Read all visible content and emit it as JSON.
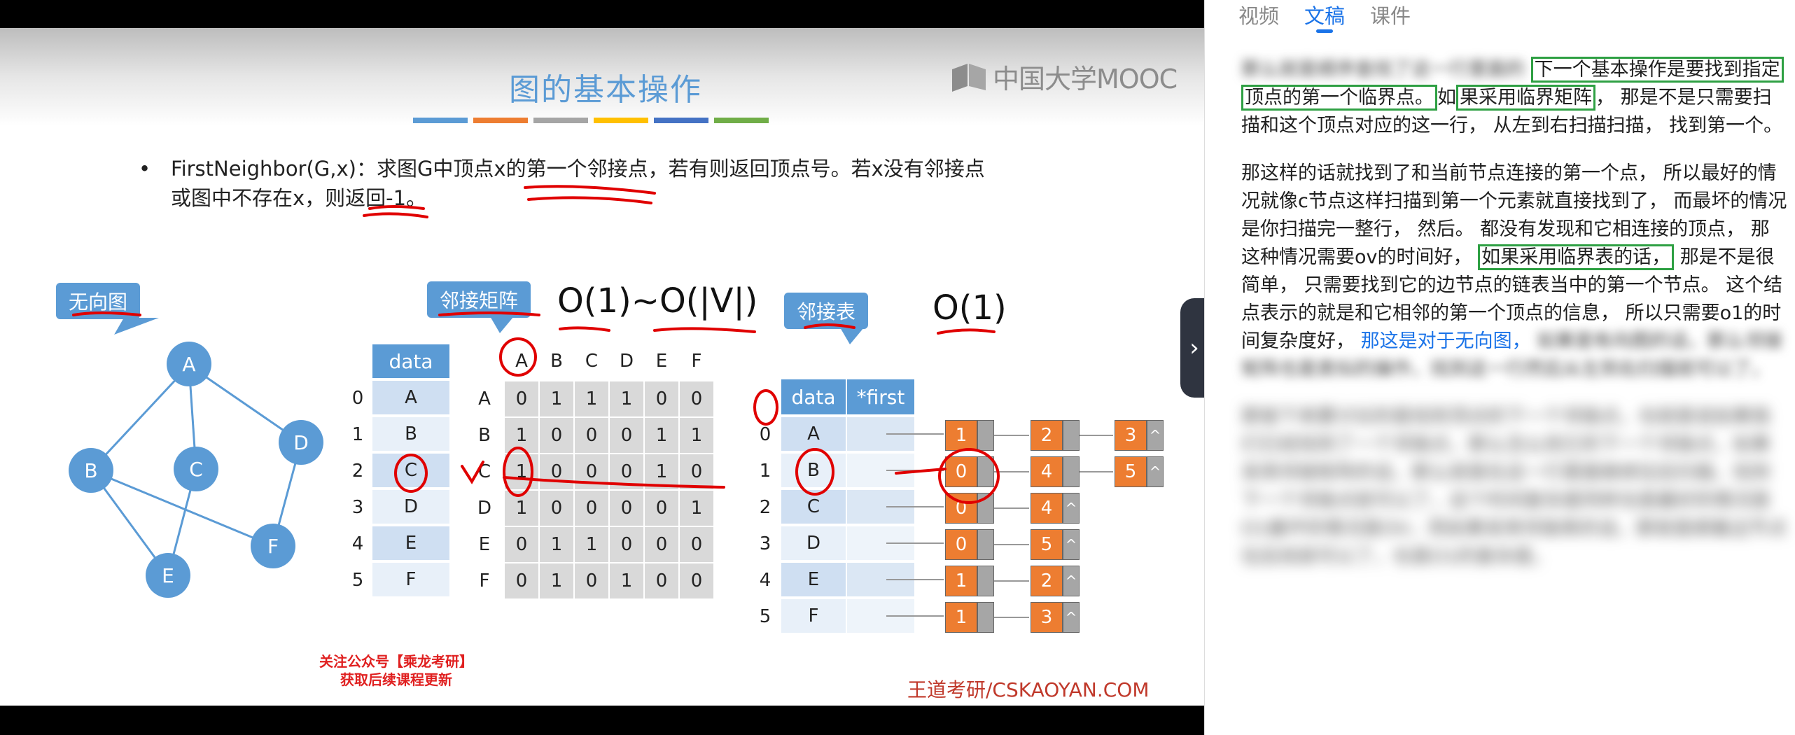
{
  "slide": {
    "title": "图的基本操作",
    "title_bar_colors": [
      "#5b9bd5",
      "#ed7d31",
      "#a5a5a5",
      "#ffc000",
      "#4472c4",
      "#70ad47"
    ],
    "logo_text": "中国大学MOOC",
    "bullet_dot": "•",
    "bullet_line1": "FirstNeighbor(G,x)：求图G中顶点x的第一个邻接点，若有则返回顶点号。若x没有邻接点",
    "bullet_line2": "或图中不存在x，则返回-1。",
    "callout_undirected": "无向图",
    "callout_matrix": "邻接矩阵",
    "callout_list": "邻接表",
    "complexity_matrix": "O(1)~O(|V|)",
    "complexity_list": "O(1)",
    "watermark_line1": "关注公众号【乘龙考研】",
    "watermark_line2": "获取后续课程更新",
    "watermark_site": "王道考研/CSKAOYAN.COM"
  },
  "graph": {
    "nodes": [
      "A",
      "B",
      "C",
      "D",
      "E",
      "F"
    ],
    "node_color": "#5b9bd5"
  },
  "vertex_table": {
    "header": "data",
    "indices": [
      "0",
      "1",
      "2",
      "3",
      "4",
      "5"
    ],
    "values": [
      "A",
      "B",
      "C",
      "D",
      "E",
      "F"
    ]
  },
  "matrix": {
    "col_headers": [
      "A",
      "B",
      "C",
      "D",
      "E",
      "F"
    ],
    "row_headers": [
      "A",
      "B",
      "C",
      "D",
      "E",
      "F"
    ],
    "rows": [
      [
        "0",
        "1",
        "1",
        "1",
        "0",
        "0"
      ],
      [
        "1",
        "0",
        "0",
        "0",
        "1",
        "1"
      ],
      [
        "1",
        "0",
        "0",
        "0",
        "1",
        "0"
      ],
      [
        "1",
        "0",
        "0",
        "0",
        "0",
        "1"
      ],
      [
        "0",
        "1",
        "1",
        "0",
        "0",
        "0"
      ],
      [
        "0",
        "1",
        "0",
        "1",
        "0",
        "0"
      ]
    ],
    "annotation_mark": "√"
  },
  "adj_list": {
    "header_data": "data",
    "header_first": "*first",
    "indices": [
      "0",
      "1",
      "2",
      "3",
      "4",
      "5"
    ],
    "vertices": [
      "A",
      "B",
      "C",
      "D",
      "E",
      "F"
    ],
    "chains": [
      [
        "1",
        "2",
        "3"
      ],
      [
        "0",
        "4",
        "5"
      ],
      [
        "0",
        "4"
      ],
      [
        "0",
        "5"
      ],
      [
        "1",
        "2"
      ],
      [
        "1",
        "3"
      ]
    ],
    "null_mark": "^",
    "node_color": "#ed7d31"
  },
  "panel": {
    "tabs": [
      "视频",
      "文稿",
      "课件"
    ],
    "active_tab": "文稿",
    "collapse_icon": "›",
    "p1_blur": "那么就是顺序查找了这一行里面的",
    "p1_box1": "下一个基本操作是要找到指定",
    "p1_box2": "顶点的第一个临界点。",
    "p1_t1": "如",
    "p1_box3": "果采用临界矩阵",
    "p1_t2": "， 那是不是只需要扫描和这个顶点对应的这一行， 从左到右扫描扫描， 找到第一个。",
    "p2_t1": "那这样的话就找到了和当前节点连接的第一个点， 所以最好的情况就像c节点这样扫描到第一个元素就直接找到了， 而最坏的情况是你扫描完一整行， 然后。 都没有发现和它相连接的顶点， 那这种情况需要ov的时间好，",
    "p2_box": "如果采用临界表的话，",
    "p2_t2": "那是不是很简单， 只需要找到它的边节点的链表当中的第一个节点。 这个结点表示的就是和它相邻的第一个顶点的信息， 所以只需要o1的时间复杂度好，",
    "p2_blue": "那这是对于无向图，",
    "p2_blur": "如果是有向图的话，那么邻接矩阵也是类似的操作，找到这一行然后从左到右扫描就可以了。",
    "p3_blur": "那接下来要讨论的是找到顶点的下一个邻接点，也就是说如果我们已经找到了一个邻接点，那么怎么找它的下一个邻接点，如果采用邻接矩阵的话，那么就是在这一行里面继续往后扫描，找到下一个邻接点就可以了，这个时间复杂度同样也是最好的情况是O1最坏的情况是OV，而如果采用邻接表的话，那就是顺着边节点往后找就可以了，也是O1的复杂度。"
  }
}
